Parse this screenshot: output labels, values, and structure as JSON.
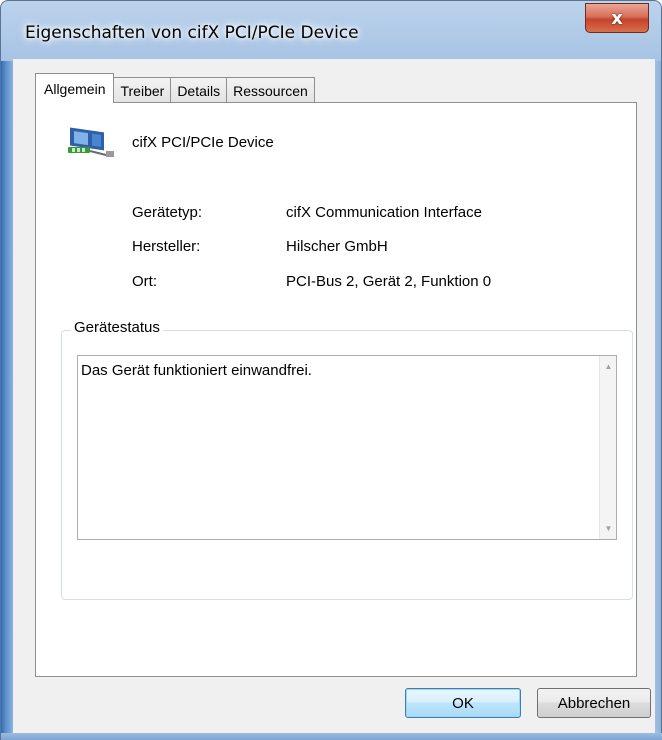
{
  "window": {
    "title": "Eigenschaften von cifX PCI/PCIe Device",
    "close_label": "x"
  },
  "tabs": [
    {
      "label": "Allgemein",
      "active": true
    },
    {
      "label": "Treiber",
      "active": false
    },
    {
      "label": "Details",
      "active": false
    },
    {
      "label": "Ressourcen",
      "active": false
    }
  ],
  "device": {
    "name": "cifX PCI/PCIe Device",
    "icon": "network-adapter-icon"
  },
  "properties": [
    {
      "label": "Gerätetyp:",
      "value": "cifX Communication Interface"
    },
    {
      "label": "Hersteller:",
      "value": "Hilscher GmbH"
    },
    {
      "label": "Ort:",
      "value": "PCI-Bus 2, Gerät 2, Funktion 0"
    }
  ],
  "status_group": {
    "title": "Gerätestatus",
    "text": "Das Gerät funktioniert einwandfrei."
  },
  "buttons": {
    "ok": "OK",
    "cancel": "Abbrechen"
  }
}
